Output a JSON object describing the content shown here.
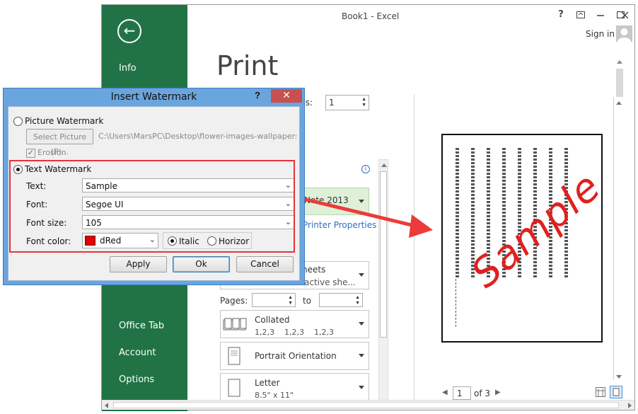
{
  "window": {
    "title": "Book1 - Excel",
    "help": "?",
    "sign_in": "Sign in"
  },
  "sidebar": {
    "back_glyph": "←",
    "items": [
      {
        "label": "Info"
      },
      {
        "label": "Office Tab"
      },
      {
        "label": "Account"
      },
      {
        "label": "Options"
      }
    ]
  },
  "print": {
    "title": "Print",
    "copies_label": "ies:",
    "copies_value": "1",
    "printer_name": "Note 2013",
    "printer_properties": "Printer Properties",
    "sheets_line1": "neets",
    "sheets_line2": "active she...",
    "pages_label": "Pages:",
    "to_label": "to",
    "collated": {
      "title": "Collated",
      "sub": "1,2,3    1,2,3    1,2,3"
    },
    "orientation": {
      "title": "Portrait Orientation"
    },
    "paper": {
      "title": "Letter",
      "sub": "8.5\" x 11\""
    },
    "nav": {
      "page": "1",
      "of": "of 3"
    }
  },
  "dialog": {
    "title": "Insert Watermark",
    "help": "?",
    "close": "✕",
    "picture_watermark": "Picture Watermark",
    "select_picture": "Select Picture (P)...",
    "picture_path": "C:\\Users\\MarsPC\\Desktop\\flower-images-wallpapers-9.jpg",
    "erosion": "Erosion",
    "text_watermark": "Text Watermark",
    "text_label": "Text:",
    "text_value": "Sample",
    "font_label": "Font:",
    "font_value": "Segoe UI",
    "size_label": "Font size:",
    "size_value": "105",
    "color_label": "Font color:",
    "color_value": "dRed",
    "color_swatch": "#e00000",
    "italic": "Italic",
    "horizontal": "Horizor",
    "apply": "Apply",
    "ok": "Ok",
    "cancel": "Cancel"
  },
  "preview": {
    "watermark_text": "Sample",
    "watermark_color": "#e02020"
  },
  "colors": {
    "accent": "#217346",
    "highlight": "#e8323c",
    "arrow": "#ee3a3a"
  }
}
